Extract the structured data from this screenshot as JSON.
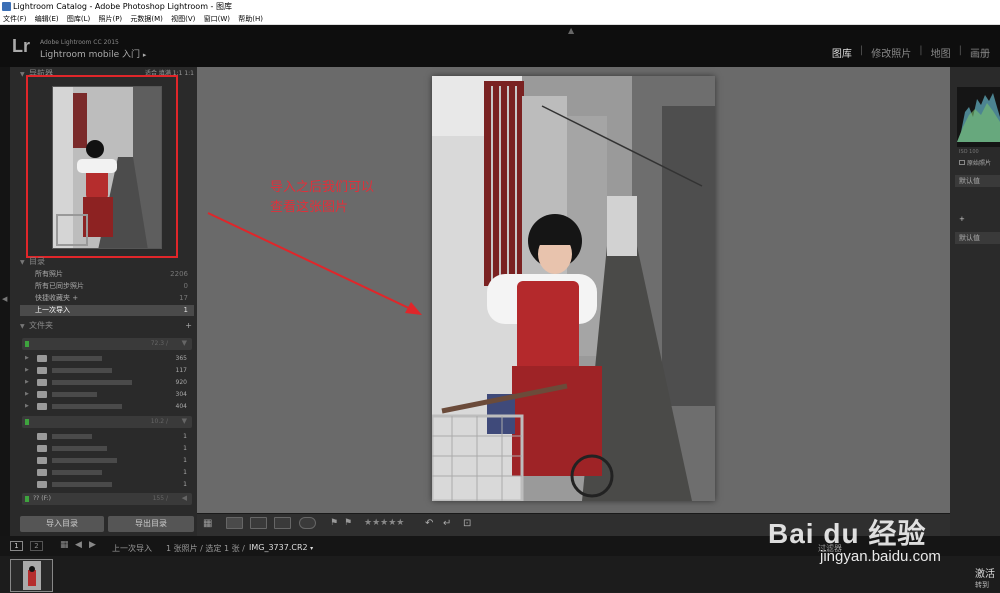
{
  "window": {
    "title": "Lightroom Catalog - Adobe Photoshop Lightroom - 图库"
  },
  "menu": [
    "文件(F)",
    "编辑(E)",
    "图库(L)",
    "照片(P)",
    "元数据(M)",
    "视图(V)",
    "窗口(W)",
    "帮助(H)"
  ],
  "identity": {
    "logo": "Lr",
    "product": "Adobe Lightroom CC 2015",
    "plate": "Lightroom mobile 入门"
  },
  "modules": [
    "图库",
    "修改照片",
    "地图",
    "画册"
  ],
  "navigator": {
    "title": "导航器",
    "options": "适合  填满  1:1  1:1"
  },
  "catalog": {
    "title": "目录",
    "rows": [
      {
        "label": "所有照片",
        "count": "2206"
      },
      {
        "label": "所有已同步照片",
        "count": "0"
      },
      {
        "label": "快捷收藏夹 +",
        "count": "17"
      },
      {
        "label": "上一次导入",
        "count": "1"
      }
    ]
  },
  "folders": {
    "title": "文件夹",
    "add": "+",
    "volume1": {
      "count": "72.3 /"
    },
    "rows1": [
      "365",
      "117",
      "920",
      "304",
      "404"
    ],
    "volume2": {
      "count": "10.2 /"
    },
    "rows2": [
      "1",
      "1",
      "1",
      "1",
      "1"
    ],
    "volume3": {
      "label": "?? (F:)",
      "count": "155 /"
    }
  },
  "buttons": {
    "import": "导入目录",
    "export": "导出目录"
  },
  "annotation": {
    "line1": "导入之后我们可以",
    "line2": "查看这张图片"
  },
  "right": {
    "iso": "ISO 100",
    "original": "原始照片",
    "default1": "默认值",
    "plus": "+",
    "default2": "默认值"
  },
  "toolbar": {
    "stars": "★★★★★"
  },
  "filmbar": {
    "page1": "1",
    "page2": "2",
    "source": "上一次导入",
    "info": "1 张照片 / 选定 1 张 /",
    "file": "IMG_3737.CR2",
    "filter": "过滤器"
  },
  "watermark": {
    "brand": "Bai du 经验",
    "url": "jingyan.baidu.com"
  },
  "activation": {
    "line1": "激活",
    "line2": "转到"
  },
  "colors": {
    "annotation": "#e0262a",
    "accent": "#e0303a"
  }
}
